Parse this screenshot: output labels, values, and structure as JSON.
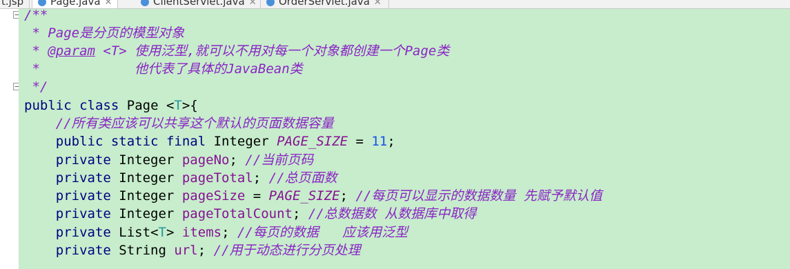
{
  "tabs": [
    {
      "label": "t.jsp"
    },
    {
      "label": "Page.java"
    },
    {
      "label": "ClientServlet.java"
    },
    {
      "label": "OrderServlet.java"
    }
  ],
  "code": {
    "doc_open": "/**",
    "doc_line1": " * Page是分页的模型对象",
    "doc_star": " * ",
    "doc_param_tag": "@param",
    "doc_param_rest": " <T> 使用泛型,就可以不用对每一个对象都创建一个Page类",
    "doc_line3": " *            他代表了具体的JavaBean类",
    "doc_close": " */",
    "l_public": "public",
    "l_class": "class",
    "l_page": "Page",
    "l_lt": "<",
    "l_T": "T",
    "l_gt_brace": ">{",
    "comment_all": "//所有类应该可以共享这个默认的页面数据容量",
    "kw_public": "public",
    "kw_static": "static",
    "kw_final": "final",
    "kw_private": "private",
    "type_integer": "Integer",
    "type_list": "List",
    "type_string": "String",
    "const_page_size": "PAGE_SIZE",
    "eq": " = ",
    "num_11": "11",
    "semi": ";",
    "f_pageNo": "pageNo",
    "c_pageNo": "//当前页码",
    "f_pageTotal": "pageTotal",
    "c_pageTotal": "//总页面数",
    "f_pageSize": "pageSize",
    "c_pageSize": "//每页可以显示的数据数量 先赋予默认值",
    "f_pageTotalCount": "pageTotalCount",
    "c_pageTotalCount": "//总数据数 从数据库中取得",
    "f_items": "items",
    "c_items": "//每页的数据   应该用泛型",
    "f_url": "url",
    "c_url": "//用于动态进行分页处理"
  }
}
